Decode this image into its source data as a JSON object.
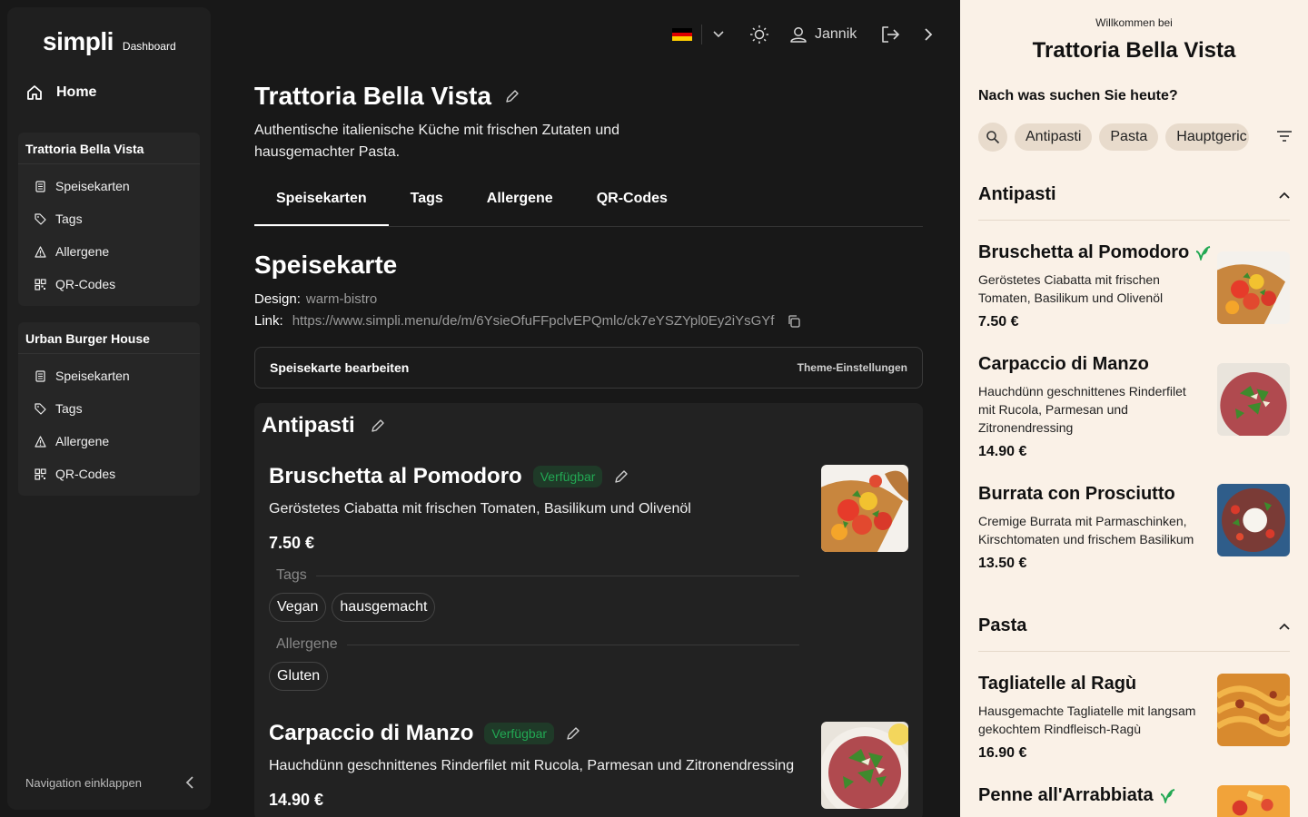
{
  "sidebar": {
    "logo_main": "simpli",
    "logo_sub": "Dashboard",
    "home": "Home",
    "groups": [
      {
        "title": "Trattoria Bella Vista",
        "items": [
          "Speisekarten",
          "Tags",
          "Allergene",
          "QR-Codes"
        ]
      },
      {
        "title": "Urban Burger House",
        "items": [
          "Speisekarten",
          "Tags",
          "Allergene",
          "QR-Codes"
        ]
      }
    ],
    "collapse": "Navigation einklappen"
  },
  "topbar": {
    "user": "Jannik",
    "flag_colors": [
      "#000000",
      "#dd0000",
      "#ffce00"
    ]
  },
  "main": {
    "title": "Trattoria Bella Vista",
    "description": "Authentische italienische Küche mit frischen Zutaten und hausgemachter Pasta.",
    "tabs": [
      "Speisekarten",
      "Tags",
      "Allergene",
      "QR-Codes"
    ],
    "section_title": "Speisekarte",
    "design_label": "Design:",
    "design_value": "warm-bistro",
    "link_label": "Link:",
    "link_value": "https://www.simpli.menu/de/m/6YsieOfuFFpclvEPQmlc/ck7eYSZYpl0Ey2iYsGYf",
    "edit_button": "Speisekarte bearbeiten",
    "theme_button": "Theme-Einstellungen",
    "category": "Antipasti",
    "items": [
      {
        "name": "Bruschetta al Pomodoro",
        "badge": "Verfügbar",
        "desc": "Geröstetes Ciabatta mit frischen Tomaten, Basilikum und Olivenöl",
        "price": "7.50 €",
        "tags_label": "Tags",
        "tags": [
          "Vegan",
          "hausgemacht"
        ],
        "allergens_label": "Allergene",
        "allergens": [
          "Gluten"
        ]
      },
      {
        "name": "Carpaccio di Manzo",
        "badge": "Verfügbar",
        "desc": "Hauchdünn geschnittenes Rinderfilet mit Rucola, Parmesan und Zitronendressing",
        "price": "14.90 €"
      }
    ]
  },
  "preview": {
    "welcome": "Willkommen bei",
    "name": "Trattoria Bella Vista",
    "question": "Nach was suchen Sie heute?",
    "chips": [
      "Antipasti",
      "Pasta",
      "Hauptgeric"
    ],
    "categories": [
      {
        "name": "Antipasti",
        "items": [
          {
            "name": "Bruschetta al Pomodoro",
            "desc": "Geröstetes Ciabatta mit frischen Tomaten, Basilikum und Olivenöl",
            "price": "7.50 €"
          },
          {
            "name": "Carpaccio di Manzo",
            "desc": "Hauchdünn geschnittenes Rinderfilet mit Rucola, Parmesan und Zitronendressing",
            "price": "14.90 €"
          },
          {
            "name": "Burrata con Prosciutto",
            "desc": "Cremige Burrata mit Parmaschinken, Kirschtomaten und frischem Basilikum",
            "price": "13.50 €"
          }
        ]
      },
      {
        "name": "Pasta",
        "items": [
          {
            "name": "Tagliatelle al Ragù",
            "desc": "Hausgemachte Tagliatelle mit langsam gekochtem Rindfleisch-Ragù",
            "price": "16.90 €"
          },
          {
            "name": "Penne all'Arrabbiata"
          }
        ]
      }
    ],
    "accent_green": "#22a853"
  }
}
